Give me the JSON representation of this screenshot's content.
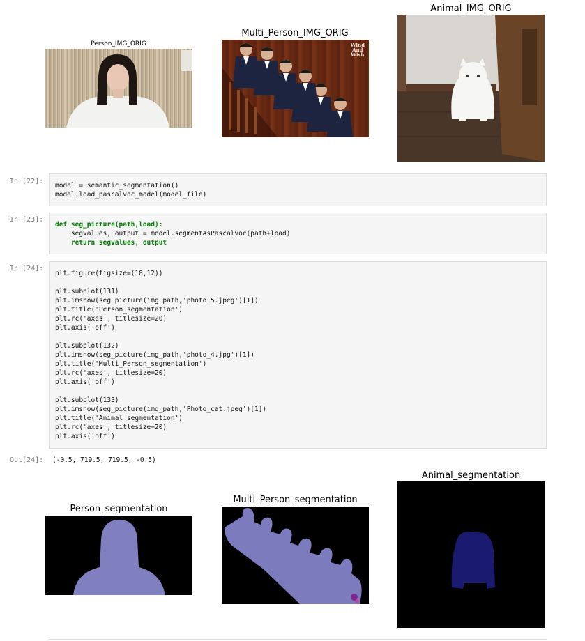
{
  "top_figures": {
    "person_title": "Person_IMG_ORIG",
    "multi_person_title": "Multi_Person_IMG_ORIG",
    "animal_title": "Animal_IMG_ORIG",
    "poster_text_line1": "Wind",
    "poster_text_line2": "And",
    "poster_text_line3": "Wish"
  },
  "cells": [
    {
      "prompt": "In [22]:",
      "lines": [
        "model = semantic_segmentation()",
        "model.load_pascalvoc_model(model_file)"
      ]
    },
    {
      "prompt": "In [23]:",
      "lines": [
        "def seg_picture(path,load):",
        "    segvalues, output = model.segmentAsPascalvoc(path+load)",
        "    return segvalues, output"
      ]
    },
    {
      "prompt": "In [24]:",
      "lines": [
        "plt.figure(figsize=(18,12))",
        "",
        "plt.subplot(131)",
        "plt.imshow(seg_picture(img_path,'photo_5.jpeg')[1])",
        "plt.title('Person_segmentation')",
        "plt.rc('axes', titlesize=20)",
        "plt.axis('off')",
        "",
        "plt.subplot(132)",
        "plt.imshow(seg_picture(img_path,'photo_4.jpg')[1])",
        "plt.title('Multi_Person_segmentation')",
        "plt.rc('axes', titlesize=20)",
        "plt.axis('off')",
        "",
        "plt.subplot(133)",
        "plt.imshow(seg_picture(img_path,'Photo_cat.jpeg')[1])",
        "plt.title('Animal_segmentation')",
        "plt.rc('axes', titlesize=20)",
        "plt.axis('off')"
      ]
    }
  ],
  "output": {
    "prompt": "Out[24]:",
    "text": "(-0.5, 719.5, 719.5, -0.5)"
  },
  "bottom_figures": {
    "person_title": "Person_segmentation",
    "multi_person_title": "Multi_Person_segmentation",
    "animal_title": "Animal_segmentation"
  },
  "colors": {
    "cell_background": "#f5f5f5",
    "cell_border": "#dcdcdc",
    "keyword": "#008000",
    "string": "#b22222",
    "prompt": "#7a7a7a",
    "person_mask": "#8080c0",
    "cat_mask": "#1a1a70",
    "mask_background": "#000000"
  }
}
